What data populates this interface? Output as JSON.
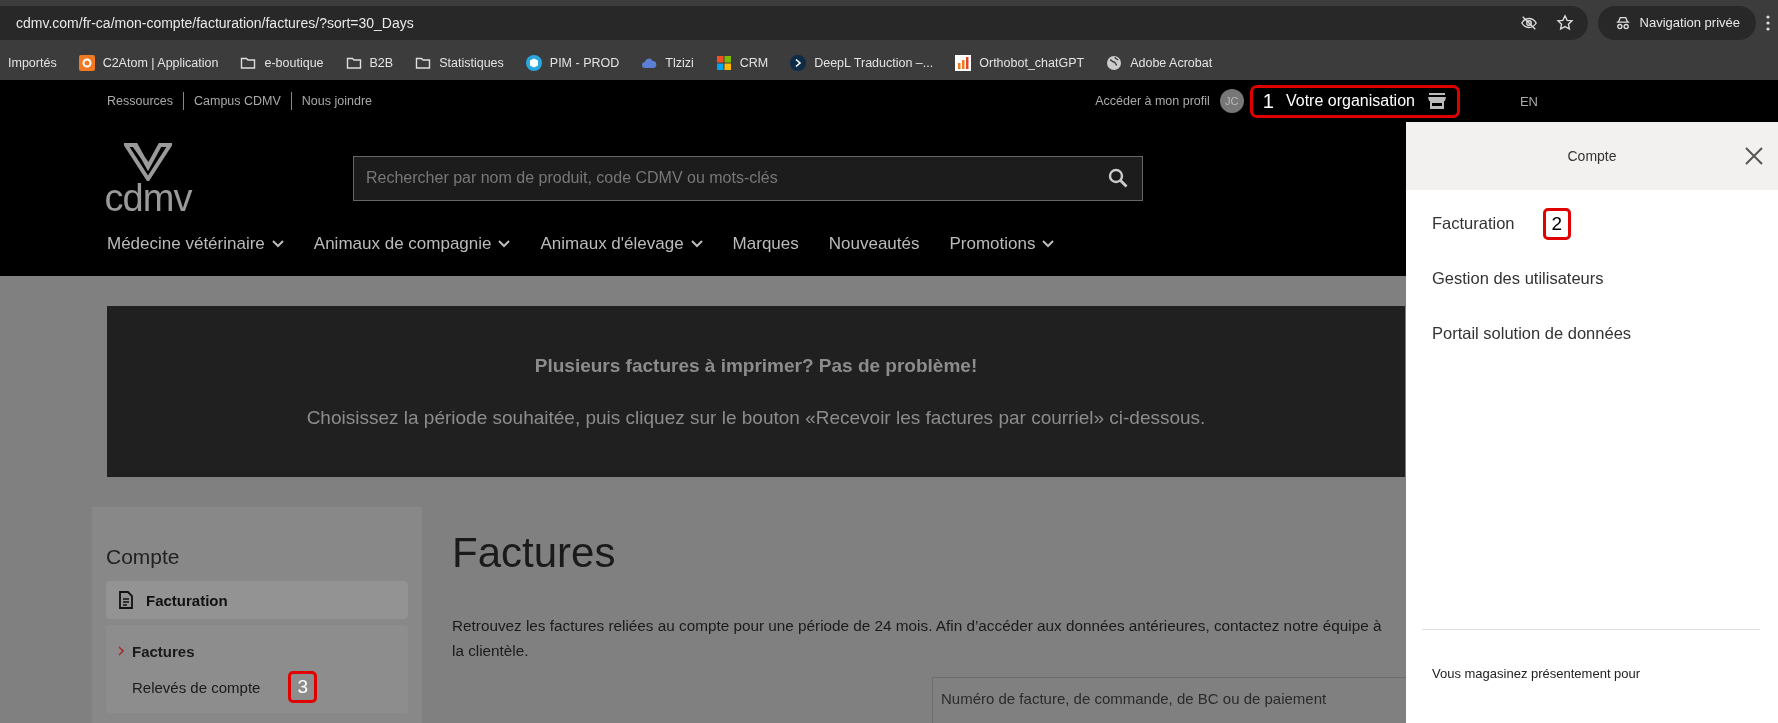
{
  "browser": {
    "url": "cdmv.com/fr-ca/mon-compte/facturation/factures/?sort=30_Days",
    "private_label": "Navigation privée",
    "bookmarks": [
      {
        "label": "Importés",
        "kind": "plain"
      },
      {
        "label": "C2Atom | Application",
        "kind": "app"
      },
      {
        "label": "e-boutique",
        "kind": "folder"
      },
      {
        "label": "B2B",
        "kind": "folder"
      },
      {
        "label": "Statistiques",
        "kind": "folder"
      },
      {
        "label": "PIM - PROD",
        "kind": "cube"
      },
      {
        "label": "Tlzizi",
        "kind": "cloud"
      },
      {
        "label": "CRM",
        "kind": "grid"
      },
      {
        "label": "DeepL Traduction –...",
        "kind": "chevron"
      },
      {
        "label": "Orthobot_chatGPT",
        "kind": "chart"
      },
      {
        "label": "Adobe Acrobat",
        "kind": "globe"
      }
    ]
  },
  "utility_links": [
    "Ressources",
    "Campus CDMV",
    "Nous joindre"
  ],
  "profile_link": "Accéder à mon profil",
  "avatar": "JC",
  "organization": {
    "label": "Votre organisation",
    "annotation": "1"
  },
  "language": "EN",
  "logo_text": "cdmv",
  "search": {
    "placeholder": "Rechercher par nom de produit, code CDMV ou mots-clés"
  },
  "nav": [
    {
      "label": "Médecine vétérinaire",
      "has_menu": true
    },
    {
      "label": "Animaux de compagnie",
      "has_menu": true
    },
    {
      "label": "Animaux d'élevage",
      "has_menu": true
    },
    {
      "label": "Marques",
      "has_menu": false
    },
    {
      "label": "Nouveautés",
      "has_menu": false
    },
    {
      "label": "Promotions",
      "has_menu": true
    }
  ],
  "banner": {
    "title": "Plusieurs factures à imprimer? Pas de problème!",
    "text": "Choisissez la période souhaitée, puis cliquez sur le bouton «Recevoir les factures par courriel» ci-dessous."
  },
  "sidebar": {
    "title": "Compte",
    "section": "Facturation",
    "items": [
      {
        "label": "Factures",
        "selected": true
      },
      {
        "label": "Relevés de compte",
        "selected": false,
        "annotation": "3"
      }
    ]
  },
  "main": {
    "title": "Factures",
    "description": "Retrouvez les factures reliées au compte pour une période de 24 mois. Afin d’accéder aux données antérieures, contactez notre équipe à la clientèle.",
    "filter_placeholder": "Numéro de facture, de commande, de BC ou de paiement"
  },
  "drawer": {
    "title": "Compte",
    "items": [
      {
        "label": "Facturation",
        "annotation": "2"
      },
      {
        "label": "Gestion des utilisateurs"
      },
      {
        "label": "Portail solution de données"
      }
    ],
    "footer": "Vous magasinez présentement pour"
  }
}
